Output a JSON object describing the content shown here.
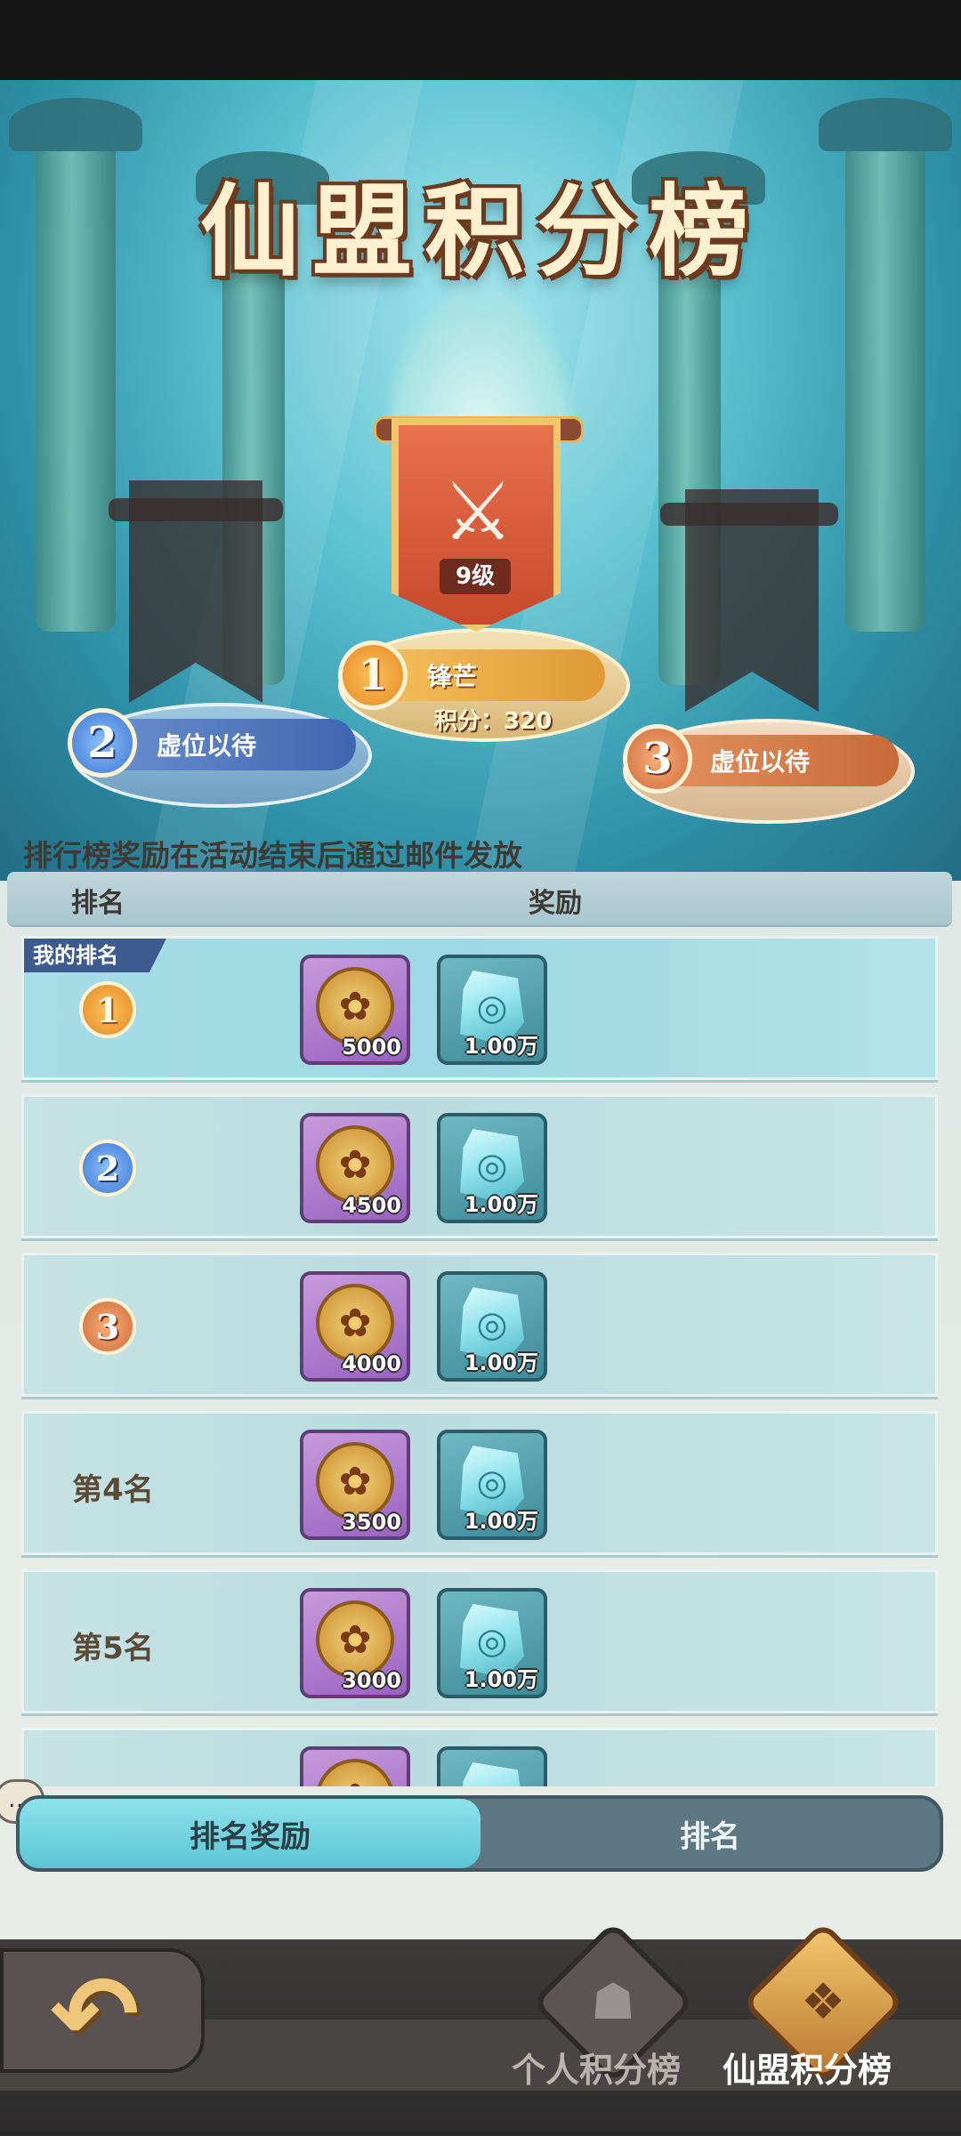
{
  "hero": {
    "title": "仙盟积分榜",
    "first": {
      "rank": "1",
      "name": "锋芒",
      "level": "9级",
      "score_label": "积分：320"
    },
    "second": {
      "rank": "2",
      "name": "虚位以待"
    },
    "third": {
      "rank": "3",
      "name": "虚位以待"
    },
    "notice": "排行榜奖励在活动结束后通过邮件发放"
  },
  "table": {
    "header_rank": "排名",
    "header_reward": "奖励",
    "my_rank_tag": "我的排名",
    "rows": [
      {
        "rank": "1",
        "coin": "5000",
        "gem": "1.00万"
      },
      {
        "rank": "2",
        "coin": "4500",
        "gem": "1.00万"
      },
      {
        "rank": "3",
        "coin": "4000",
        "gem": "1.00万"
      },
      {
        "rank": "第4名",
        "coin": "3500",
        "gem": "1.00万"
      },
      {
        "rank": "第5名",
        "coin": "3000",
        "gem": "1.00万"
      }
    ]
  },
  "tabs": {
    "active": "排名奖励",
    "inactive": "排名"
  },
  "nav": {
    "personal": "个人积分榜",
    "alliance": "仙盟积分榜"
  },
  "colors": {
    "accent": "#5bc5d3",
    "gold": "#e38a26",
    "silver": "#3d78d0",
    "bronze": "#cf6b3a"
  }
}
